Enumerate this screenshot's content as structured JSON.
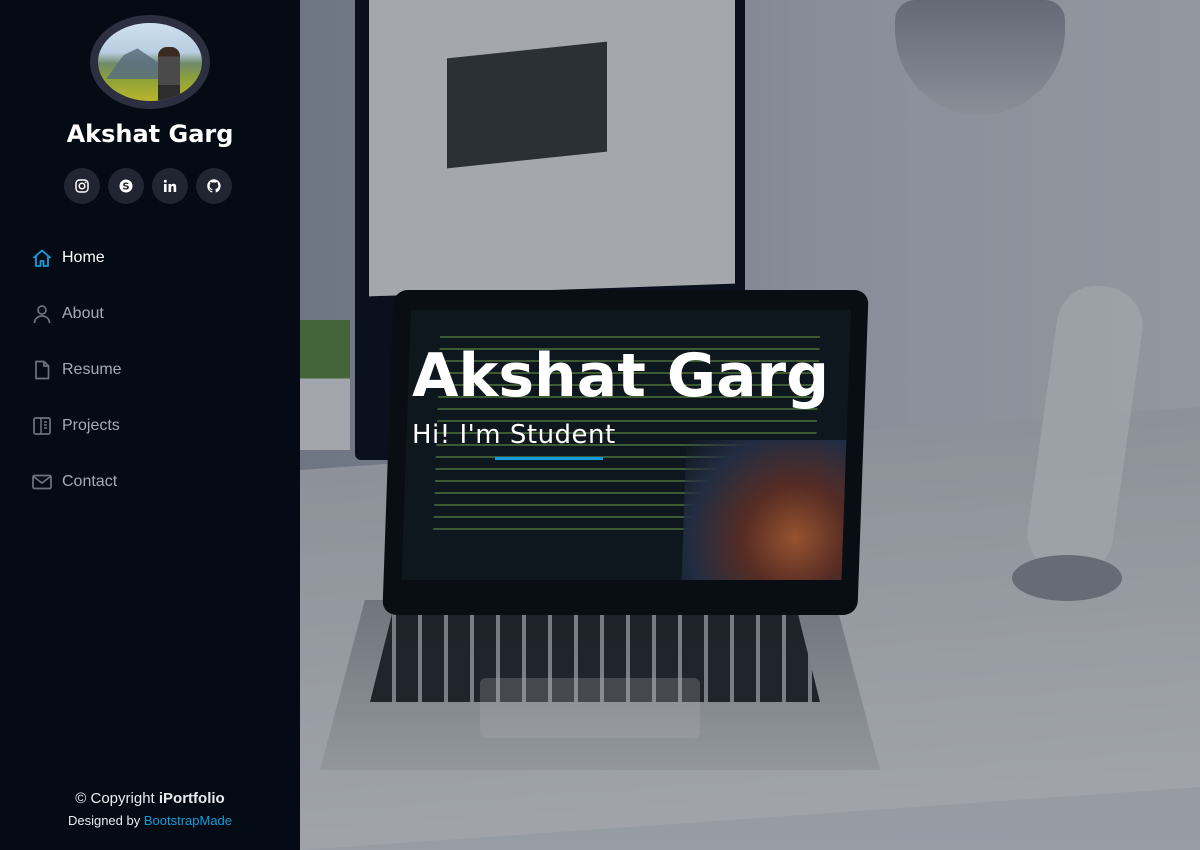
{
  "sidebar": {
    "name": "Akshat Garg",
    "social": [
      {
        "icon": "instagram-icon"
      },
      {
        "icon": "skype-icon"
      },
      {
        "icon": "linkedin-icon"
      },
      {
        "icon": "github-icon"
      }
    ],
    "nav": [
      {
        "label": "Home",
        "icon": "home-icon",
        "active": true
      },
      {
        "label": "About",
        "icon": "person-icon",
        "active": false
      },
      {
        "label": "Resume",
        "icon": "file-icon",
        "active": false
      },
      {
        "label": "Projects",
        "icon": "book-icon",
        "active": false
      },
      {
        "label": "Contact",
        "icon": "envelope-icon",
        "active": false
      }
    ]
  },
  "footer": {
    "copyright_prefix": "© Copyright ",
    "brand": "iPortfolio",
    "designed_by": "Designed by ",
    "designer_link": "BootstrapMade"
  },
  "hero": {
    "title": "Akshat Garg",
    "subtitle": "Hi! I'm Student"
  },
  "colors": {
    "accent": "#149ddd",
    "sidebar_bg": "#040b14",
    "social_bg": "#212431",
    "nav_text": "#a8a9b4"
  }
}
